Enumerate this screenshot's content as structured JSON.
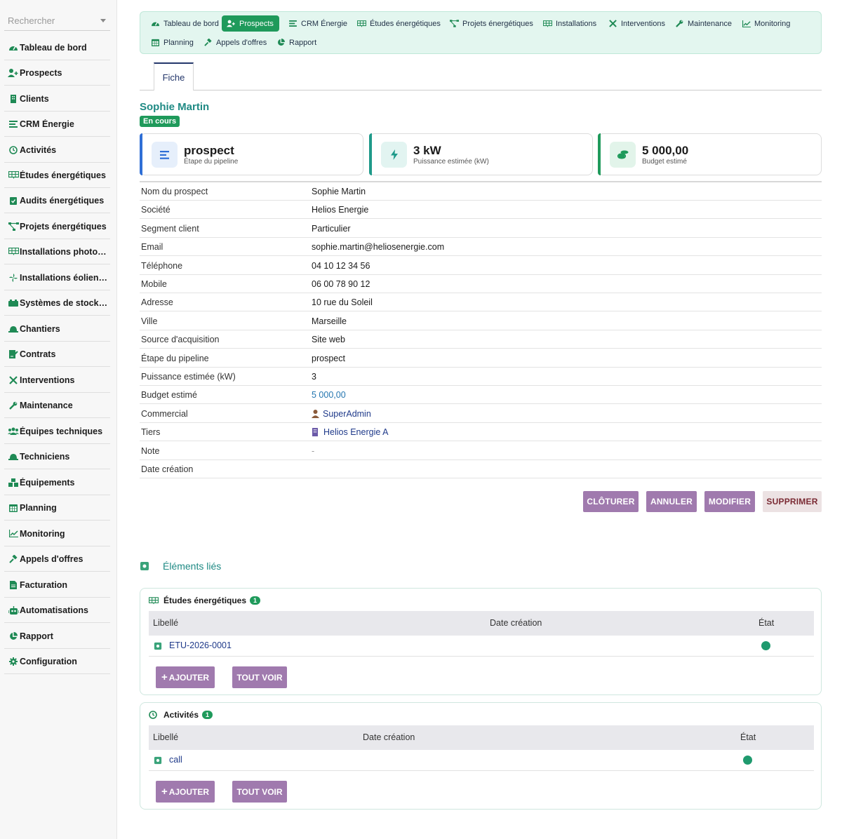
{
  "sidebar": {
    "search_placeholder": "Rechercher",
    "items": [
      {
        "label": "Tableau de bord",
        "icon": "dashboard-icon"
      },
      {
        "label": "Prospects",
        "icon": "user-plus-icon"
      },
      {
        "label": "Clients",
        "icon": "building-icon"
      },
      {
        "label": "CRM Énergie",
        "icon": "bars-icon"
      },
      {
        "label": "Activités",
        "icon": "history-icon"
      },
      {
        "label": "Études énergétiques",
        "icon": "solar-panel-icon"
      },
      {
        "label": "Audits énergétiques",
        "icon": "clipboard-check-icon"
      },
      {
        "label": "Projets énergétiques",
        "icon": "project-diagram-icon"
      },
      {
        "label": "Installations photovoltaïques",
        "icon": "solar-panel-icon"
      },
      {
        "label": "Installations éoliennes",
        "icon": "fan-icon"
      },
      {
        "label": "Systèmes de stockage",
        "icon": "battery-icon"
      },
      {
        "label": "Chantiers",
        "icon": "hard-hat-icon"
      },
      {
        "label": "Contrats",
        "icon": "file-signature-icon"
      },
      {
        "label": "Interventions",
        "icon": "tools-icon"
      },
      {
        "label": "Maintenance",
        "icon": "wrench-icon"
      },
      {
        "label": "Équipes techniques",
        "icon": "users-icon"
      },
      {
        "label": "Techniciens",
        "icon": "hard-hat-icon"
      },
      {
        "label": "Équipements",
        "icon": "boxes-icon"
      },
      {
        "label": "Planning",
        "icon": "calendar-icon"
      },
      {
        "label": "Monitoring",
        "icon": "chart-line-icon"
      },
      {
        "label": "Appels d'offres",
        "icon": "gavel-icon"
      },
      {
        "label": "Facturation",
        "icon": "invoice-icon"
      },
      {
        "label": "Automatisations",
        "icon": "robot-icon"
      },
      {
        "label": "Rapport",
        "icon": "pie-chart-icon"
      },
      {
        "label": "Configuration",
        "icon": "gear-icon"
      }
    ]
  },
  "topnav": {
    "items": [
      {
        "label": "Tableau de bord",
        "icon": "dashboard-icon",
        "active": false
      },
      {
        "label": "Prospects",
        "icon": "user-plus-icon",
        "active": true
      },
      {
        "label": "CRM Énergie",
        "icon": "bars-icon",
        "active": false
      },
      {
        "label": "Études énergétiques",
        "icon": "solar-panel-icon",
        "active": false
      },
      {
        "label": "Projets énergétiques",
        "icon": "project-diagram-icon",
        "active": false
      },
      {
        "label": "Installations",
        "icon": "solar-panel-icon",
        "active": false
      },
      {
        "label": "Interventions",
        "icon": "tools-icon",
        "active": false
      },
      {
        "label": "Maintenance",
        "icon": "wrench-icon",
        "active": false
      },
      {
        "label": "Monitoring",
        "icon": "chart-line-icon",
        "active": false
      },
      {
        "label": "Planning",
        "icon": "calendar-icon",
        "active": false
      },
      {
        "label": "Appels d'offres",
        "icon": "gavel-icon",
        "active": false
      },
      {
        "label": "Rapport",
        "icon": "pie-chart-icon",
        "active": false
      }
    ]
  },
  "tab": {
    "label": "Fiche"
  },
  "record": {
    "title": "Sophie Martin",
    "status": "En cours"
  },
  "kpis": [
    {
      "value": "prospect",
      "label": "Étape du pipeline",
      "icon": "bars-icon",
      "accent": "#2f6fd6",
      "icon_bg": "#e6effb"
    },
    {
      "value": "3 kW",
      "label": "Puissance estimée (kW)",
      "icon": "bolt-icon",
      "accent": "#1f9a8a",
      "icon_bg": "#e2f4f1"
    },
    {
      "value": "5 000,00",
      "label": "Budget estimé",
      "icon": "coins-icon",
      "accent": "#1f9a5b",
      "icon_bg": "#e2f4ea"
    }
  ],
  "fields": [
    {
      "key": "Nom du prospect",
      "value": "Sophie Martin"
    },
    {
      "key": "Société",
      "value": "Helios Energie"
    },
    {
      "key": "Segment client",
      "value": "Particulier"
    },
    {
      "key": "Email",
      "value": "sophie.martin@heliosenergie.com"
    },
    {
      "key": "Téléphone",
      "value": "04 10 12 34 56"
    },
    {
      "key": "Mobile",
      "value": "06 00 78 90 12"
    },
    {
      "key": "Adresse",
      "value": "10 rue du Soleil"
    },
    {
      "key": "Ville",
      "value": "Marseille"
    },
    {
      "key": "Source d'acquisition",
      "value": "Site web"
    },
    {
      "key": "Étape du pipeline",
      "value": "prospect"
    },
    {
      "key": "Puissance estimée (kW)",
      "value": "3"
    },
    {
      "key": "Budget estimé",
      "value": "5 000,00"
    },
    {
      "key": "Commercial",
      "value": "SuperAdmin"
    },
    {
      "key": "Tiers",
      "value": "Helios Energie A"
    },
    {
      "key": "Note",
      "value": "-"
    },
    {
      "key": "Date création",
      "value": ""
    }
  ],
  "actions": {
    "close": "CLÔTURER",
    "cancel": "ANNULER",
    "edit": "MODIFIER",
    "delete": "SUPPRIMER"
  },
  "related": {
    "title": "Éléments liés",
    "panels": [
      {
        "title": "Études énergétiques",
        "count": "1",
        "icon": "solar-panel-icon",
        "columns": [
          "Libellé",
          "Date création",
          "État"
        ],
        "rows": [
          {
            "label": "ETU-2026-0001",
            "date": "",
            "status_color": "#1f9a6e"
          }
        ],
        "add": "AJOUTER",
        "view_all": "TOUT VOIR"
      },
      {
        "title": "Activités",
        "count": "1",
        "icon": "history-icon",
        "columns": [
          "Libellé",
          "Date création",
          "État"
        ],
        "rows": [
          {
            "label": "call",
            "date": "",
            "status_color": "#1f9a6e"
          }
        ],
        "add": "AJOUTER",
        "view_all": "TOUT VOIR"
      }
    ]
  }
}
